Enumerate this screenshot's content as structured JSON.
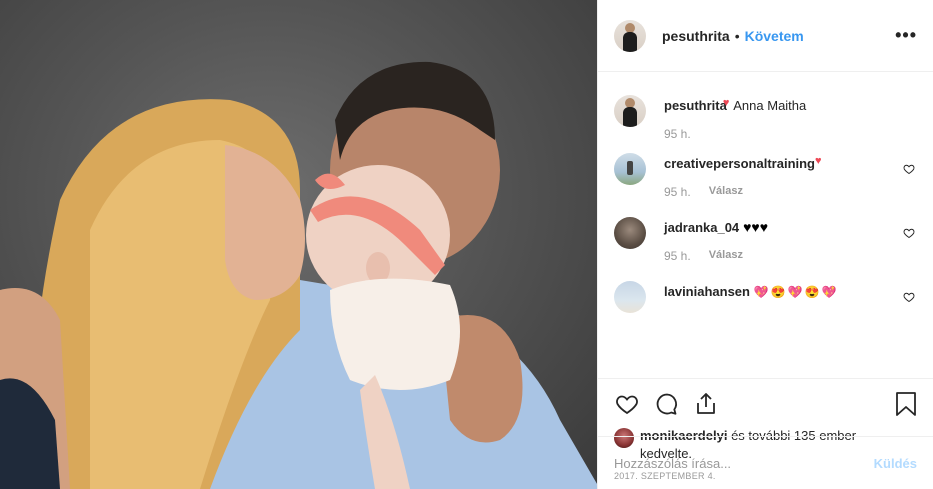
{
  "header": {
    "username": "pesuthrita",
    "separator": "•",
    "follow_label": "Követem",
    "more_icon": "more-horizontal-icon"
  },
  "caption": {
    "username": "pesuthrita",
    "text": "Anna Maitha",
    "time": "95 h."
  },
  "comments": [
    {
      "username": "creativepersonaltraining",
      "text": "",
      "time": "95 h.",
      "reply_label": "Válasz"
    },
    {
      "username": "jadranka_04",
      "text": "♥♥♥",
      "time": "95 h.",
      "reply_label": "Válasz"
    },
    {
      "username": "laviniahansen",
      "text": "",
      "time": "",
      "reply_label": ""
    }
  ],
  "actions": {
    "icons": [
      "heart-icon",
      "comment-icon",
      "share-icon",
      "bookmark-icon"
    ]
  },
  "likes": {
    "username": "monikaerdelyi",
    "rest": "és további 135 ember",
    "line2": "kedvelte."
  },
  "date": "2017. SZEPTEMBER 4.",
  "add_comment": {
    "placeholder": "Hozzászólás írása...",
    "send_label": "Küldés"
  },
  "colors": {
    "accent": "#3897f0",
    "send_disabled": "#b3dbff",
    "heart_red": "#ed4956",
    "muted": "#999999"
  }
}
